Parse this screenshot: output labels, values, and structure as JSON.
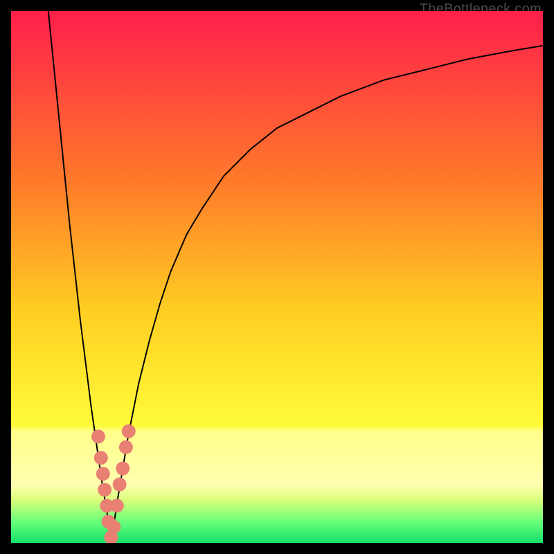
{
  "attribution": "TheBottleneck.com",
  "colors": {
    "gradient_top": "#ff1f4b",
    "gradient_mid_upper": "#ff6a2a",
    "gradient_mid": "#ffd022",
    "gradient_mid_lower": "#fffb3a",
    "gradient_yellow_band": "#ffff8a",
    "gradient_bottom": "#14e06a",
    "curve": "#000000",
    "marker": "#e98074",
    "frame_bg": "#000000"
  },
  "chart_data": {
    "type": "line",
    "title": "",
    "xlabel": "",
    "ylabel": "",
    "xlim": [
      0,
      100
    ],
    "ylim": [
      0,
      100
    ],
    "series": [
      {
        "name": "left-branch",
        "x": [
          7,
          8,
          9,
          10,
          11,
          12,
          13,
          14,
          15,
          16,
          17,
          18,
          18.8
        ],
        "y": [
          100,
          90,
          80,
          70,
          60,
          51,
          42,
          34,
          26,
          19,
          12,
          6,
          0
        ]
      },
      {
        "name": "right-branch",
        "x": [
          18.8,
          20,
          22,
          24,
          26,
          28,
          30,
          33,
          36,
          40,
          45,
          50,
          56,
          62,
          70,
          78,
          86,
          94,
          100
        ],
        "y": [
          0,
          8,
          20,
          30,
          38,
          45,
          51,
          58,
          63,
          69,
          74,
          78,
          81,
          84,
          87,
          89,
          91,
          92.5,
          93.5
        ]
      }
    ],
    "markers": [
      {
        "x": 16.4,
        "y": 20
      },
      {
        "x": 16.9,
        "y": 16
      },
      {
        "x": 17.3,
        "y": 13
      },
      {
        "x": 17.6,
        "y": 10
      },
      {
        "x": 18.0,
        "y": 7
      },
      {
        "x": 18.3,
        "y": 4
      },
      {
        "x": 18.8,
        "y": 1
      },
      {
        "x": 19.3,
        "y": 3
      },
      {
        "x": 19.9,
        "y": 7
      },
      {
        "x": 20.4,
        "y": 11
      },
      {
        "x": 21.0,
        "y": 14
      },
      {
        "x": 21.6,
        "y": 18
      },
      {
        "x": 22.1,
        "y": 21
      }
    ]
  }
}
